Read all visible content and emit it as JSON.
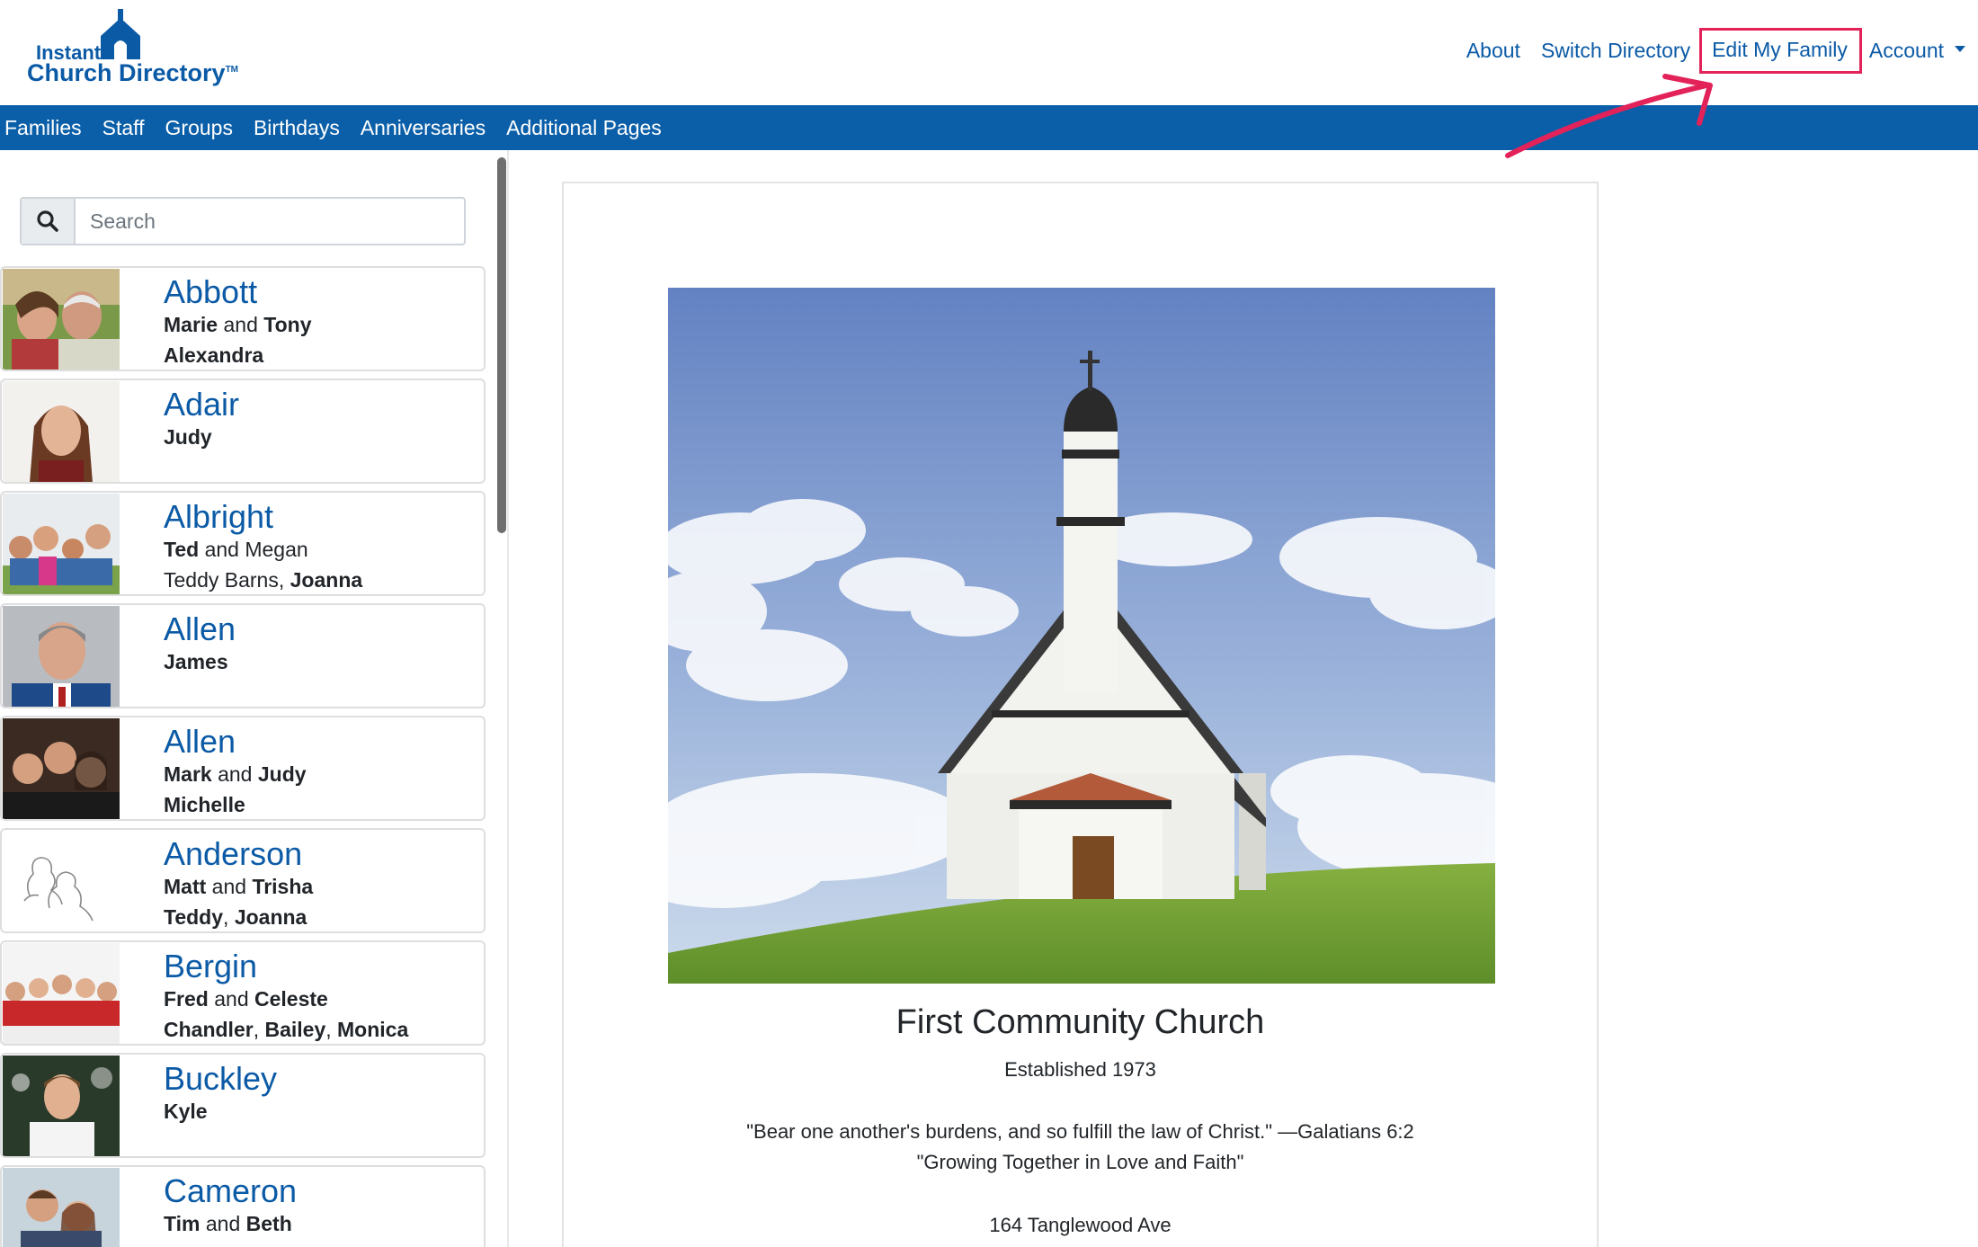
{
  "logo": {
    "line1": "Instant",
    "line2": "Church Directory",
    "tm": "TM"
  },
  "topnav": {
    "about": "About",
    "switch_directory": "Switch Directory",
    "edit_my_family": "Edit My Family",
    "account": "Account"
  },
  "nav": {
    "families": "Families",
    "staff": "Staff",
    "groups": "Groups",
    "birthdays": "Birthdays",
    "anniversaries": "Anniversaries",
    "additional_pages": "Additional Pages"
  },
  "search": {
    "placeholder": "Search"
  },
  "families": [
    {
      "name": "Abbott",
      "l1a": "Marie",
      "l1and": " and ",
      "l1b": "Tony",
      "l2a": "Alexandra",
      "l2sep": "",
      "l2b": "",
      "l2sep2": "",
      "l2c": ""
    },
    {
      "name": "Adair",
      "l1a": "Judy",
      "l1and": "",
      "l1b": "",
      "l2a": "",
      "l2sep": "",
      "l2b": "",
      "l2sep2": "",
      "l2c": ""
    },
    {
      "name": "Albright",
      "l1a": "Ted",
      "l1and": " and ",
      "l1b": "Megan",
      "l2a": "Teddy Barns",
      "l2sep": ", ",
      "l2b": "Joanna",
      "l2sep2": "",
      "l2c": ""
    },
    {
      "name": "Allen",
      "l1a": "James",
      "l1and": "",
      "l1b": "",
      "l2a": "",
      "l2sep": "",
      "l2b": "",
      "l2sep2": "",
      "l2c": ""
    },
    {
      "name": "Allen",
      "l1a": "Mark",
      "l1and": " and ",
      "l1b": "Judy",
      "l2a": "Michelle",
      "l2sep": "",
      "l2b": "",
      "l2sep2": "",
      "l2c": ""
    },
    {
      "name": "Anderson",
      "l1a": "Matt",
      "l1and": " and ",
      "l1b": "Trisha",
      "l2a": "Teddy",
      "l2sep": ", ",
      "l2b": "Joanna",
      "l2sep2": "",
      "l2c": ""
    },
    {
      "name": "Bergin",
      "l1a": "Fred",
      "l1and": " and ",
      "l1b": "Celeste",
      "l2a": "Chandler",
      "l2sep": ", ",
      "l2b": "Bailey",
      "l2sep2": ", ",
      "l2c": "Monica"
    },
    {
      "name": "Buckley",
      "l1a": "Kyle",
      "l1and": "",
      "l1b": "",
      "l2a": "",
      "l2sep": "",
      "l2b": "",
      "l2sep2": "",
      "l2c": ""
    },
    {
      "name": "Cameron",
      "l1a": "Tim",
      "l1and": " and ",
      "l1b": "Beth",
      "l2a": "",
      "l2sep": "",
      "l2b": "",
      "l2sep2": "",
      "l2c": ""
    }
  ],
  "church": {
    "name": "First Community Church",
    "established": "Established 1973",
    "verse": "\"Bear one another's burdens, and so fulfill the law of Christ.\" —Galatians 6:2",
    "motto": "\"Growing Together in Love and Faith\"",
    "address": "164 Tanglewood Ave"
  },
  "colors": {
    "brand_blue": "#0b5fa8",
    "link_blue": "#0b5aa6",
    "highlight": "#e3225a"
  }
}
